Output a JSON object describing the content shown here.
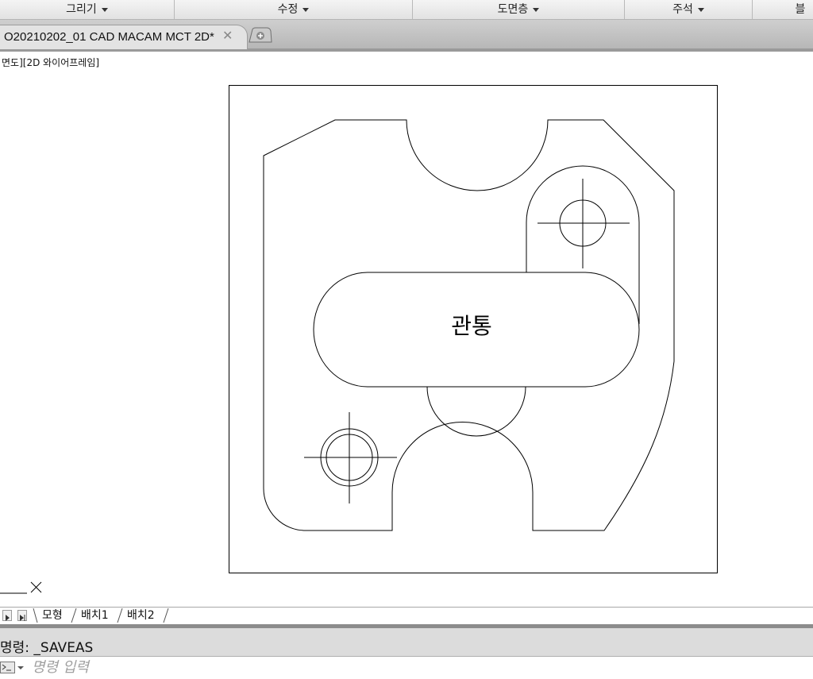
{
  "ribbon": {
    "panels": [
      {
        "label": "그리기"
      },
      {
        "label": "수정"
      },
      {
        "label": "도면층"
      },
      {
        "label": "주석"
      },
      {
        "label": "블"
      }
    ]
  },
  "document_tab": {
    "title": "O20210202_01 CAD MACAM MCT 2D*",
    "close_glyph": "✕"
  },
  "viewport": {
    "label": "면도][2D 와이어프레임]",
    "center_text": "관통"
  },
  "layout_tabs": [
    {
      "label": "모형",
      "active": true
    },
    {
      "label": "배치1",
      "active": false
    },
    {
      "label": "배치2",
      "active": false
    }
  ],
  "command": {
    "history": "명령: _SAVEAS",
    "placeholder": "명령 입력"
  },
  "colors": {
    "line": "#000000",
    "ribbon_bg": "#e8e8e8",
    "tab_bar_bg": "#c2c2c2",
    "command_bg": "#dcdcdc"
  },
  "icons": [
    "chevron-down-icon",
    "close-icon",
    "new-tab-icon",
    "ucs-icon",
    "play-first-icon",
    "play-last-icon",
    "command-prompt-icon"
  ]
}
